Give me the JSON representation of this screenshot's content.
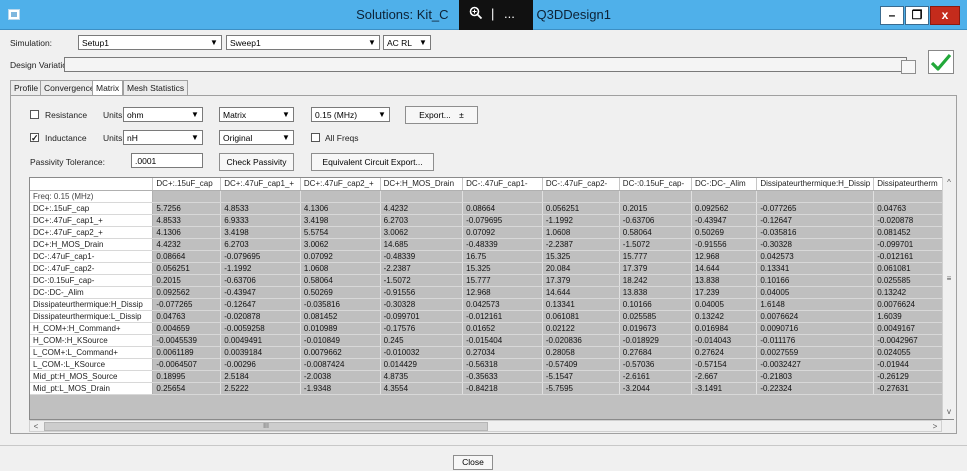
{
  "window": {
    "title_left": "Solutions: Kit_C",
    "title_right": "- Q3DDesign1",
    "controls": {
      "minimize": "–",
      "restore": "❐",
      "close": "x"
    }
  },
  "capture_toolbar": {
    "zoom_icon": "magnifier-icon",
    "sep": "|",
    "more": "..."
  },
  "simulation": {
    "label": "Simulation:",
    "setup_value": "Setup1",
    "sweep_value": "Sweep1",
    "mode_value": "AC RL"
  },
  "design_variation": {
    "label": "Design Variation:",
    "value": ""
  },
  "tabs": [
    {
      "label": "Profile",
      "active": false
    },
    {
      "label": "Convergence",
      "active": false
    },
    {
      "label": "Matrix",
      "active": true
    },
    {
      "label": "Mesh Statistics",
      "active": false
    }
  ],
  "resistance": {
    "checkbox_label": "Resistance",
    "checked": false,
    "units_label": "Units:",
    "units_value": "ohm",
    "matrix_type": "Matrix",
    "frequency": "0.15 (MHz)",
    "export_label": "Export...",
    "export_icon": "pin-icon"
  },
  "inductance": {
    "checkbox_label": "Inductance",
    "checked": true,
    "check_mark": "✓",
    "units_label": "Units:",
    "units_value": "nH",
    "matrix_type": "Original",
    "all_freqs_label": "All Freqs",
    "all_freqs_checked": false
  },
  "passivity": {
    "label": "Passivity Tolerance:",
    "value": ".0001",
    "check_label": "Check Passivity",
    "equivalent_label": "Equivalent Circuit Export..."
  },
  "matrix": {
    "columns": [
      "DC+:.15uF_cap",
      "DC+:.47uF_cap1_+",
      "DC+:.47uF_cap2_+",
      "DC+:H_MOS_Drain",
      "DC-:.47uF_cap1-",
      "DC-:.47uF_cap2-",
      "DC-:0.15uF_cap-",
      "DC-:DC-_Alim",
      "Dissipateurthermique:H_Dissip",
      "Dissipateurtherm"
    ],
    "freq_row": "Freq: 0.15 (MHz)",
    "rows": [
      {
        "name": "DC+:.15uF_cap",
        "values": [
          "5.7256",
          "4.8533",
          "4.1306",
          "4.4232",
          "0.08664",
          "0.056251",
          "0.2015",
          "0.092562",
          "-0.077265",
          "0.04763"
        ]
      },
      {
        "name": "DC+:.47uF_cap1_+",
        "values": [
          "4.8533",
          "6.9333",
          "3.4198",
          "6.2703",
          "-0.079695",
          "-1.1992",
          "-0.63706",
          "-0.43947",
          "-0.12647",
          "-0.020878"
        ]
      },
      {
        "name": "DC+:.47uF_cap2_+",
        "values": [
          "4.1306",
          "3.4198",
          "5.5754",
          "3.0062",
          "0.07092",
          "1.0608",
          "0.58064",
          "0.50269",
          "-0.035816",
          "0.081452"
        ]
      },
      {
        "name": "DC+:H_MOS_Drain",
        "values": [
          "4.4232",
          "6.2703",
          "3.0062",
          "14.685",
          "-0.48339",
          "-2.2387",
          "-1.5072",
          "-0.91556",
          "-0.30328",
          "-0.099701"
        ]
      },
      {
        "name": "DC-:.47uF_cap1-",
        "values": [
          "0.08664",
          "-0.079695",
          "0.07092",
          "-0.48339",
          "16.75",
          "15.325",
          "15.777",
          "12.968",
          "0.042573",
          "-0.012161"
        ]
      },
      {
        "name": "DC-:.47uF_cap2-",
        "values": [
          "0.056251",
          "-1.1992",
          "1.0608",
          "-2.2387",
          "15.325",
          "20.084",
          "17.379",
          "14.644",
          "0.13341",
          "0.061081"
        ]
      },
      {
        "name": "DC-:0.15uF_cap-",
        "values": [
          "0.2015",
          "-0.63706",
          "0.58064",
          "-1.5072",
          "15.777",
          "17.379",
          "18.242",
          "13.838",
          "0.10166",
          "0.025585"
        ]
      },
      {
        "name": "DC-:DC-_Alim",
        "values": [
          "0.092562",
          "-0.43947",
          "0.50269",
          "-0.91556",
          "12.968",
          "14.644",
          "13.838",
          "17.239",
          "0.04005",
          "0.13242"
        ]
      },
      {
        "name": "Dissipateurthermique:H_Dissip",
        "values": [
          "-0.077265",
          "-0.12647",
          "-0.035816",
          "-0.30328",
          "0.042573",
          "0.13341",
          "0.10166",
          "0.04005",
          "1.6148",
          "0.0076624"
        ]
      },
      {
        "name": "Dissipateurthermique:L_Dissip",
        "values": [
          "0.04763",
          "-0.020878",
          "0.081452",
          "-0.099701",
          "-0.012161",
          "0.061081",
          "0.025585",
          "0.13242",
          "0.0076624",
          "1.6039"
        ]
      },
      {
        "name": "H_COM+:H_Command+",
        "values": [
          "0.004659",
          "-0.0059258",
          "0.010989",
          "-0.17576",
          "0.01652",
          "0.02122",
          "0.019673",
          "0.016984",
          "0.0090716",
          "0.0049167"
        ]
      },
      {
        "name": "H_COM-:H_KSource",
        "values": [
          "-0.0045539",
          "0.0049491",
          "-0.010849",
          "0.245",
          "-0.015404",
          "-0.020836",
          "-0.018929",
          "-0.014043",
          "-0.011176",
          "-0.0042967"
        ]
      },
      {
        "name": "L_COM+:L_Command+",
        "values": [
          "0.0061189",
          "0.0039184",
          "0.0079662",
          "-0.010032",
          "0.27034",
          "0.28058",
          "0.27684",
          "0.27624",
          "0.0027559",
          "0.024055"
        ]
      },
      {
        "name": "L_COM-:L_KSource",
        "values": [
          "-0.0064507",
          "-0.00296",
          "-0.0087424",
          "0.014429",
          "-0.56318",
          "-0.57409",
          "-0.57036",
          "-0.57154",
          "-0.0032427",
          "-0.01944"
        ]
      },
      {
        "name": "Mid_pt:H_MOS_Source",
        "values": [
          "0.18995",
          "2.5184",
          "-2.0038",
          "4.8735",
          "-0.35633",
          "-5.1547",
          "-2.6161",
          "-2.667",
          "-0.21803",
          "-0.26129"
        ]
      },
      {
        "name": "Mid_pt:L_MOS_Drain",
        "values": [
          "0.25654",
          "2.5222",
          "-1.9348",
          "4.3554",
          "-0.84218",
          "-5.7595",
          "-3.2044",
          "-3.1491",
          "-0.22324",
          "-0.27631"
        ]
      }
    ]
  },
  "hscroll": {
    "grip": "III",
    "left_arrow": "<",
    "right_arrow": ">"
  },
  "vscroll": {
    "grip": "≡",
    "up_arrow": "^",
    "down_arrow": "v"
  },
  "footer": {
    "close_label": "Close"
  },
  "colors": {
    "titlebar": "#4fb0ea",
    "ok_check": "#22a83a",
    "close_button": "#c42b1c",
    "cell_fill": "#bfbfbf"
  }
}
